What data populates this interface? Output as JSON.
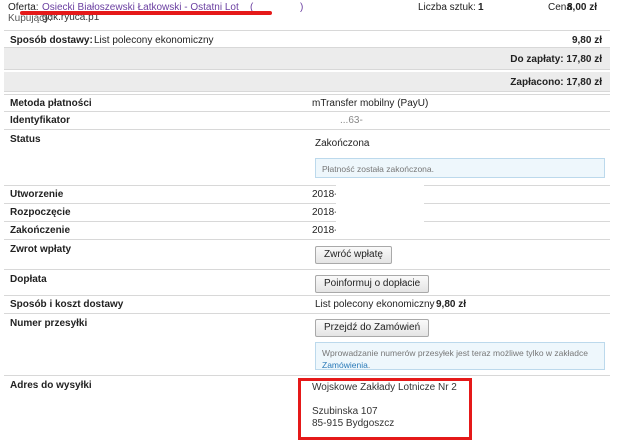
{
  "top": {
    "offer_label": "Oferta:",
    "offer_link": "Osiecki Białoszewski Łatkowski - Ostatni Lot",
    "offer_paren_open": "(",
    "offer_paren_close": ")",
    "buyer_label": "Kupujący:",
    "buyer_value": "gdk.ryuca.p1",
    "qty_label": "Liczba sztuk:",
    "qty_value": "1",
    "price_label": "Cena",
    "price_value": "8,00 zł"
  },
  "delivery_line": {
    "label": "Sposób dostawy:",
    "value": "List polecony ekonomiczny",
    "amount": "9,80 zł"
  },
  "totals": {
    "to_pay": "Do zapłaty: 17,80 zł",
    "paid": "Zapłacono: 17,80 zł"
  },
  "details": {
    "payment_method": {
      "label": "Metoda płatności",
      "value": "mTransfer mobilny (PayU)"
    },
    "identifier": {
      "label": "Identyfikator",
      "value": "...63-"
    },
    "status": {
      "label": "Status",
      "value": "Zakończona",
      "note": "Płatność została zakończona."
    },
    "created": {
      "label": "Utworzenie",
      "value": "2018-"
    },
    "started": {
      "label": "Rozpoczęcie",
      "value": "2018-"
    },
    "finished": {
      "label": "Zakończenie",
      "value": "2018-"
    },
    "refund": {
      "label": "Zwrot wpłaty",
      "button": "Zwróć wpłatę"
    },
    "surcharge": {
      "label": "Dopłata",
      "button": "Poinformuj o dopłacie"
    },
    "delivery_cost": {
      "label": "Sposób i koszt dostawy",
      "value": "List polecony ekonomiczny",
      "amount": "9,80 zł"
    },
    "tracking": {
      "label": "Numer przesyłki",
      "button": "Przejdź do Zamówień",
      "note_text": "Wprowadzanie numerów przesyłek jest teraz możliwe tylko w zakładce ",
      "note_link": "Zamówienia"
    },
    "address": {
      "label": "Adres do wysyłki",
      "line1": "Wojskowe Zakłady Lotnicze Nr 2",
      "line2": "Szubinska 107",
      "line3": "85-915 Bydgoszcz"
    }
  },
  "colors": {
    "highlight": "#e51919",
    "link": "#6a3ea0",
    "info_link": "#2a7ab8"
  }
}
